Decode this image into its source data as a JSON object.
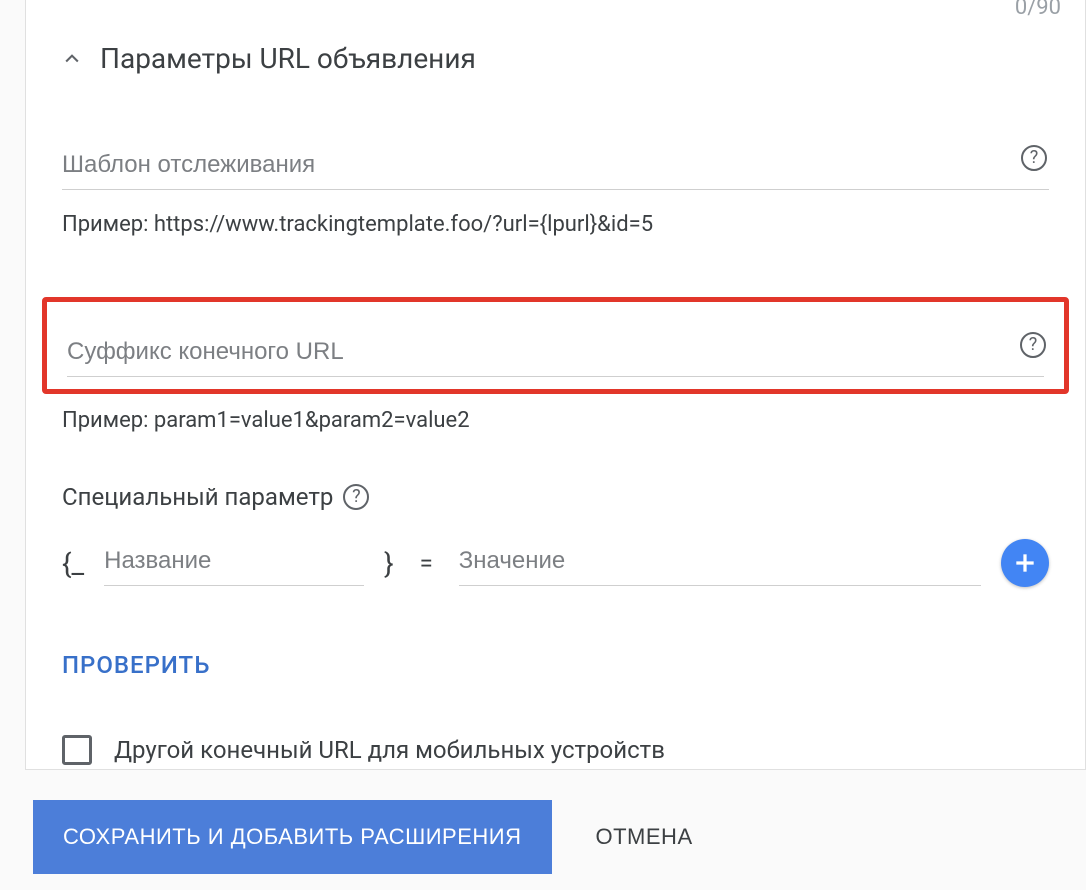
{
  "counter": "0/90",
  "section": {
    "title": "Параметры URL объявления"
  },
  "tracking": {
    "placeholder": "Шаблон отслеживания",
    "example": "Пример: https://www.trackingtemplate.foo/?url={lpurl}&id=5"
  },
  "suffix": {
    "placeholder": "Суффикс конечного URL",
    "example": "Пример: param1=value1&param2=value2"
  },
  "customParam": {
    "label": "Специальный параметр",
    "namePlaceholder": "Название",
    "valuePlaceholder": "Значение"
  },
  "verify": "ПРОВЕРИТЬ",
  "mobile": {
    "label": "Другой конечный URL для мобильных устройств"
  },
  "buttons": {
    "save": "СОХРАНИТЬ И ДОБАВИТЬ РАСШИРЕНИЯ",
    "cancel": "ОТМЕНА"
  }
}
